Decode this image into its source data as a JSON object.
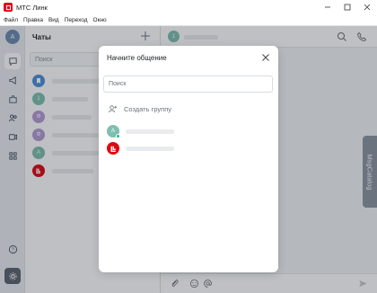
{
  "window": {
    "title": "МТС Линк",
    "controls": [
      "minimize-icon",
      "maximize-icon",
      "close-icon"
    ]
  },
  "menu": {
    "items": [
      "Файл",
      "Правка",
      "Вид",
      "Переход",
      "Окно"
    ]
  },
  "rail": {
    "avatar_letter": "A",
    "buttons": [
      "chat-bubble-icon",
      "megaphone-icon",
      "puzzle-icon",
      "contacts-icon",
      "video-icon",
      "apps-icon"
    ],
    "bottom": [
      "help-icon",
      "settings-icon"
    ]
  },
  "chats": {
    "title": "Чаты",
    "search_placeholder": "Поиск",
    "items": [
      {
        "avatar": "bookmark-icon",
        "color": "#4a90d9",
        "letter": ""
      },
      {
        "avatar": "",
        "color": "#7fbfaf",
        "letter": "1"
      },
      {
        "avatar": "",
        "color": "#b69bd6",
        "letter": "Ф"
      },
      {
        "avatar": "",
        "color": "#b69bd6",
        "letter": "Ф"
      },
      {
        "avatar": "",
        "color": "#7fbfaf",
        "letter": "A"
      },
      {
        "avatar": "mts-logo-icon",
        "color": "#e30611",
        "letter": ""
      }
    ]
  },
  "main": {
    "header_avatar_letter": "1",
    "header_icons": [
      "search-icon",
      "phone-icon"
    ],
    "footer_icons": [
      "attach-icon",
      "emoji-icon",
      "mention-icon",
      "send-icon"
    ],
    "side_tab": "MsgCatalog"
  },
  "modal": {
    "title": "Начните общение",
    "search_placeholder": "Поиск",
    "create_group_label": "Создать группу",
    "contacts": [
      {
        "letter": "A",
        "color": "#7fbfaf",
        "online": true
      },
      {
        "letter": "",
        "color": "#e30611",
        "online": false,
        "avatar": "mts-logo-icon"
      }
    ]
  },
  "colors": {
    "brand": "#e30611",
    "online": "#26b37a"
  }
}
